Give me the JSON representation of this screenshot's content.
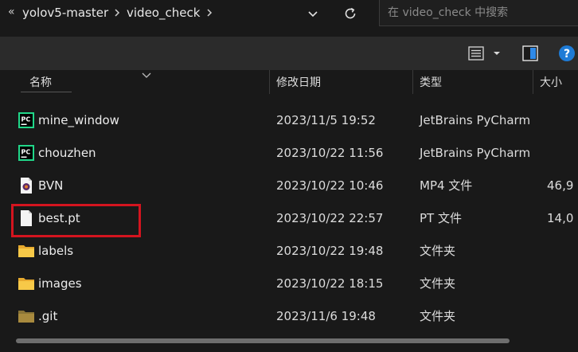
{
  "addressbar": {
    "overflow_glyph": "«",
    "crumbs": [
      "yolov5-master",
      "video_check"
    ],
    "search_placeholder": "在 video_check 中搜索"
  },
  "columns": {
    "name": "名称",
    "date": "修改日期",
    "type": "类型",
    "size": "大小"
  },
  "files": [
    {
      "name": "mine_window",
      "date": "2023/11/5 19:52",
      "type": "JetBrains PyCharm",
      "size": "",
      "icon": "pycharm-icon"
    },
    {
      "name": "chouzhen",
      "date": "2023/10/22 11:56",
      "type": "JetBrains PyCharm",
      "size": "",
      "icon": "pycharm-icon"
    },
    {
      "name": "BVN",
      "date": "2023/10/22 10:46",
      "type": "MP4 文件",
      "size": "46,9",
      "icon": "video-file-icon"
    },
    {
      "name": "best.pt",
      "date": "2023/10/22 22:57",
      "type": "PT 文件",
      "size": "14,0",
      "icon": "blank-file-icon"
    },
    {
      "name": "labels",
      "date": "2023/10/22 19:48",
      "type": "文件夹",
      "size": "",
      "icon": "folder-icon"
    },
    {
      "name": "images",
      "date": "2023/10/22 18:15",
      "type": "文件夹",
      "size": "",
      "icon": "folder-icon"
    },
    {
      "name": ".git",
      "date": "2023/11/6 19:48",
      "type": "文件夹",
      "size": "",
      "icon": "folder-dim-icon"
    }
  ],
  "colors": {
    "background": "#191919",
    "command_bar": "#2b2b2b",
    "highlight": "#d4141f",
    "folder": "#f2c14e",
    "pycharm_green": "#21d789",
    "help_blue": "#1e7bd6"
  }
}
